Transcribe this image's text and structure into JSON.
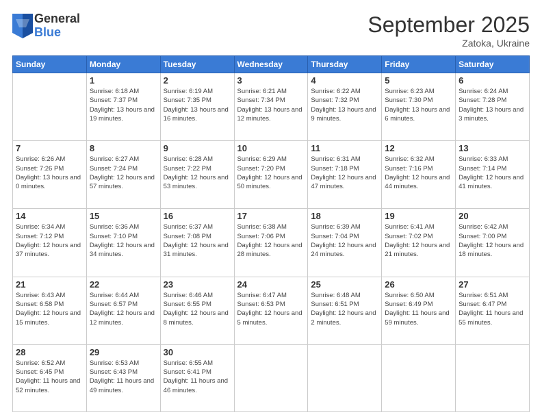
{
  "logo": {
    "general": "General",
    "blue": "Blue"
  },
  "header": {
    "month": "September 2025",
    "location": "Zatoka, Ukraine"
  },
  "weekdays": [
    "Sunday",
    "Monday",
    "Tuesday",
    "Wednesday",
    "Thursday",
    "Friday",
    "Saturday"
  ],
  "weeks": [
    [
      {
        "day": "",
        "sunrise": "",
        "sunset": "",
        "daylight": ""
      },
      {
        "day": "1",
        "sunrise": "Sunrise: 6:18 AM",
        "sunset": "Sunset: 7:37 PM",
        "daylight": "Daylight: 13 hours and 19 minutes."
      },
      {
        "day": "2",
        "sunrise": "Sunrise: 6:19 AM",
        "sunset": "Sunset: 7:35 PM",
        "daylight": "Daylight: 13 hours and 16 minutes."
      },
      {
        "day": "3",
        "sunrise": "Sunrise: 6:21 AM",
        "sunset": "Sunset: 7:34 PM",
        "daylight": "Daylight: 13 hours and 12 minutes."
      },
      {
        "day": "4",
        "sunrise": "Sunrise: 6:22 AM",
        "sunset": "Sunset: 7:32 PM",
        "daylight": "Daylight: 13 hours and 9 minutes."
      },
      {
        "day": "5",
        "sunrise": "Sunrise: 6:23 AM",
        "sunset": "Sunset: 7:30 PM",
        "daylight": "Daylight: 13 hours and 6 minutes."
      },
      {
        "day": "6",
        "sunrise": "Sunrise: 6:24 AM",
        "sunset": "Sunset: 7:28 PM",
        "daylight": "Daylight: 13 hours and 3 minutes."
      }
    ],
    [
      {
        "day": "7",
        "sunrise": "Sunrise: 6:26 AM",
        "sunset": "Sunset: 7:26 PM",
        "daylight": "Daylight: 13 hours and 0 minutes."
      },
      {
        "day": "8",
        "sunrise": "Sunrise: 6:27 AM",
        "sunset": "Sunset: 7:24 PM",
        "daylight": "Daylight: 12 hours and 57 minutes."
      },
      {
        "day": "9",
        "sunrise": "Sunrise: 6:28 AM",
        "sunset": "Sunset: 7:22 PM",
        "daylight": "Daylight: 12 hours and 53 minutes."
      },
      {
        "day": "10",
        "sunrise": "Sunrise: 6:29 AM",
        "sunset": "Sunset: 7:20 PM",
        "daylight": "Daylight: 12 hours and 50 minutes."
      },
      {
        "day": "11",
        "sunrise": "Sunrise: 6:31 AM",
        "sunset": "Sunset: 7:18 PM",
        "daylight": "Daylight: 12 hours and 47 minutes."
      },
      {
        "day": "12",
        "sunrise": "Sunrise: 6:32 AM",
        "sunset": "Sunset: 7:16 PM",
        "daylight": "Daylight: 12 hours and 44 minutes."
      },
      {
        "day": "13",
        "sunrise": "Sunrise: 6:33 AM",
        "sunset": "Sunset: 7:14 PM",
        "daylight": "Daylight: 12 hours and 41 minutes."
      }
    ],
    [
      {
        "day": "14",
        "sunrise": "Sunrise: 6:34 AM",
        "sunset": "Sunset: 7:12 PM",
        "daylight": "Daylight: 12 hours and 37 minutes."
      },
      {
        "day": "15",
        "sunrise": "Sunrise: 6:36 AM",
        "sunset": "Sunset: 7:10 PM",
        "daylight": "Daylight: 12 hours and 34 minutes."
      },
      {
        "day": "16",
        "sunrise": "Sunrise: 6:37 AM",
        "sunset": "Sunset: 7:08 PM",
        "daylight": "Daylight: 12 hours and 31 minutes."
      },
      {
        "day": "17",
        "sunrise": "Sunrise: 6:38 AM",
        "sunset": "Sunset: 7:06 PM",
        "daylight": "Daylight: 12 hours and 28 minutes."
      },
      {
        "day": "18",
        "sunrise": "Sunrise: 6:39 AM",
        "sunset": "Sunset: 7:04 PM",
        "daylight": "Daylight: 12 hours and 24 minutes."
      },
      {
        "day": "19",
        "sunrise": "Sunrise: 6:41 AM",
        "sunset": "Sunset: 7:02 PM",
        "daylight": "Daylight: 12 hours and 21 minutes."
      },
      {
        "day": "20",
        "sunrise": "Sunrise: 6:42 AM",
        "sunset": "Sunset: 7:00 PM",
        "daylight": "Daylight: 12 hours and 18 minutes."
      }
    ],
    [
      {
        "day": "21",
        "sunrise": "Sunrise: 6:43 AM",
        "sunset": "Sunset: 6:58 PM",
        "daylight": "Daylight: 12 hours and 15 minutes."
      },
      {
        "day": "22",
        "sunrise": "Sunrise: 6:44 AM",
        "sunset": "Sunset: 6:57 PM",
        "daylight": "Daylight: 12 hours and 12 minutes."
      },
      {
        "day": "23",
        "sunrise": "Sunrise: 6:46 AM",
        "sunset": "Sunset: 6:55 PM",
        "daylight": "Daylight: 12 hours and 8 minutes."
      },
      {
        "day": "24",
        "sunrise": "Sunrise: 6:47 AM",
        "sunset": "Sunset: 6:53 PM",
        "daylight": "Daylight: 12 hours and 5 minutes."
      },
      {
        "day": "25",
        "sunrise": "Sunrise: 6:48 AM",
        "sunset": "Sunset: 6:51 PM",
        "daylight": "Daylight: 12 hours and 2 minutes."
      },
      {
        "day": "26",
        "sunrise": "Sunrise: 6:50 AM",
        "sunset": "Sunset: 6:49 PM",
        "daylight": "Daylight: 11 hours and 59 minutes."
      },
      {
        "day": "27",
        "sunrise": "Sunrise: 6:51 AM",
        "sunset": "Sunset: 6:47 PM",
        "daylight": "Daylight: 11 hours and 55 minutes."
      }
    ],
    [
      {
        "day": "28",
        "sunrise": "Sunrise: 6:52 AM",
        "sunset": "Sunset: 6:45 PM",
        "daylight": "Daylight: 11 hours and 52 minutes."
      },
      {
        "day": "29",
        "sunrise": "Sunrise: 6:53 AM",
        "sunset": "Sunset: 6:43 PM",
        "daylight": "Daylight: 11 hours and 49 minutes."
      },
      {
        "day": "30",
        "sunrise": "Sunrise: 6:55 AM",
        "sunset": "Sunset: 6:41 PM",
        "daylight": "Daylight: 11 hours and 46 minutes."
      },
      {
        "day": "",
        "sunrise": "",
        "sunset": "",
        "daylight": ""
      },
      {
        "day": "",
        "sunrise": "",
        "sunset": "",
        "daylight": ""
      },
      {
        "day": "",
        "sunrise": "",
        "sunset": "",
        "daylight": ""
      },
      {
        "day": "",
        "sunrise": "",
        "sunset": "",
        "daylight": ""
      }
    ]
  ]
}
